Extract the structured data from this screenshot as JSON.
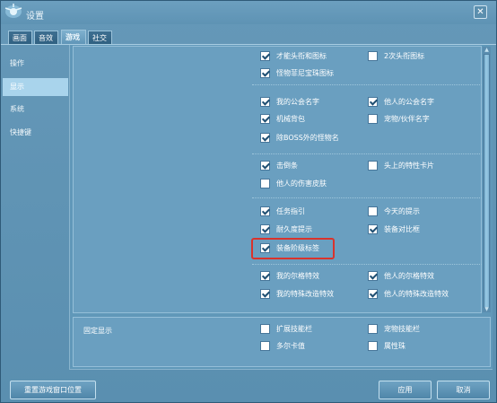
{
  "window": {
    "title": "设置",
    "close_symbol": "✕"
  },
  "tabs": [
    {
      "label": "画面",
      "active": false
    },
    {
      "label": "音效",
      "active": false
    },
    {
      "label": "游戏",
      "active": true
    },
    {
      "label": "社交",
      "active": false
    }
  ],
  "sidebar": [
    {
      "label": "操作",
      "active": false
    },
    {
      "label": "显示",
      "active": true
    },
    {
      "label": "系统",
      "active": false
    },
    {
      "label": "快捷键",
      "active": false
    }
  ],
  "options": {
    "avatar_title": {
      "label": "才能头衔和图标",
      "checked": true
    },
    "secondary_title": {
      "label": "2次头衔图标",
      "checked": false
    },
    "monster_gem": {
      "label": "怪物菲尼宝珠图标",
      "checked": true
    },
    "my_guild": {
      "label": "我的公会名字",
      "checked": true
    },
    "other_guild": {
      "label": "他人的公会名字",
      "checked": true
    },
    "mech_backpack": {
      "label": "机械背包",
      "checked": true
    },
    "pet_name": {
      "label": "宠物/伙伴名字",
      "checked": false
    },
    "monster_names": {
      "label": "除BOSS外的怪物名",
      "checked": true
    },
    "knockdown": {
      "label": "击倒条",
      "checked": true
    },
    "head_trait_card": {
      "label": "头上的特性卡片",
      "checked": false
    },
    "others_damage_skin": {
      "label": "他人的伤害皮肤",
      "checked": false
    },
    "quest_guide": {
      "label": "任务指引",
      "checked": true
    },
    "today_tip": {
      "label": "今天的提示",
      "checked": false
    },
    "durability_tip": {
      "label": "耐久度提示",
      "checked": true
    },
    "gear_compare": {
      "label": "装备对比框",
      "checked": true
    },
    "gear_tier_label": {
      "label": "装备阶级标签",
      "checked": true
    },
    "my_erg": {
      "label": "我的尔格特效",
      "checked": true
    },
    "others_erg": {
      "label": "他人的尔格特效",
      "checked": true
    },
    "my_special_mod": {
      "label": "我的特殊改造特效",
      "checked": true
    },
    "others_special_mod": {
      "label": "他人的特殊改造特效",
      "checked": true
    }
  },
  "fixed_display": {
    "title": "固定显示",
    "options": {
      "expand_skillbar": {
        "label": "扩展技能栏",
        "checked": false
      },
      "pet_skillbar": {
        "label": "宠物技能栏",
        "checked": false
      },
      "dorka_value": {
        "label": "多尔卡值",
        "checked": false
      },
      "attribute_orb": {
        "label": "属性珠",
        "checked": false
      }
    }
  },
  "buttons": {
    "reset_window": "重置游戏窗口位置",
    "apply": "应用",
    "cancel": "取消"
  },
  "colors": {
    "highlight": "#d9332c",
    "accent": "#a9d4ec",
    "panel": "#6a9fc0"
  }
}
